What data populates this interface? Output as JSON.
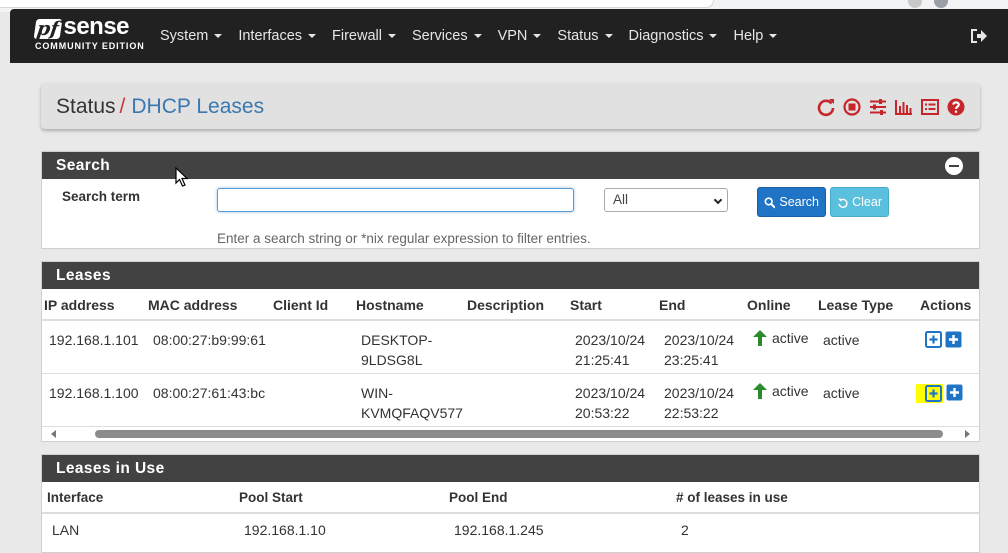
{
  "brand": {
    "logo_pf": "pf",
    "logo_sense": "sense",
    "edition": "COMMUNITY EDITION"
  },
  "nav": {
    "items": [
      "System",
      "Interfaces",
      "Firewall",
      "Services",
      "VPN",
      "Status",
      "Diagnostics",
      "Help"
    ],
    "logout_icon": "sign-out-icon"
  },
  "breadcrumb": {
    "parent": "Status",
    "separator": "/",
    "current": "DHCP Leases"
  },
  "header_icons": [
    "restart-icon",
    "stop-icon",
    "sliders-icon",
    "bar-chart-icon",
    "list-icon",
    "help-icon"
  ],
  "colors": {
    "accent_red": "#c6262b",
    "link_blue": "#3b78b0",
    "panel_heading": "#424242",
    "active_green": "#2b8a2b",
    "highlight": "#ffff00"
  },
  "search": {
    "heading": "Search",
    "label": "Search term",
    "input_value": "",
    "select_value": "All",
    "search_button": "Search",
    "clear_button": "Clear",
    "help_text": "Enter a search string or *nix regular expression to filter entries."
  },
  "leases": {
    "heading": "Leases",
    "columns": [
      "IP address",
      "MAC address",
      "Client Id",
      "Hostname",
      "Description",
      "Start",
      "End",
      "Online",
      "Lease Type",
      "Actions"
    ],
    "rows": [
      {
        "ip": "192.168.1.101",
        "mac": "08:00:27:b9:99:61",
        "client_id": "",
        "hostname_1": "DESKTOP-",
        "hostname_2": "9LDSG8L",
        "description": "",
        "start_date": "2023/10/24",
        "start_time": "21:25:41",
        "end_date": "2023/10/24",
        "end_time": "23:25:41",
        "online": "active",
        "lease_type": "active"
      },
      {
        "ip": "192.168.1.100",
        "mac": "08:00:27:61:43:bc",
        "client_id": "",
        "hostname_1": "WIN-",
        "hostname_2": "KVMQFAQV577",
        "description": "",
        "start_date": "2023/10/24",
        "start_time": "20:53:22",
        "end_date": "2023/10/24",
        "end_time": "22:53:22",
        "online": "active",
        "lease_type": "active"
      }
    ]
  },
  "in_use": {
    "heading": "Leases in Use",
    "columns": [
      "Interface",
      "Pool Start",
      "Pool End",
      "# of leases in use"
    ],
    "rows": [
      {
        "interface": "LAN",
        "pool_start": "192.168.1.10",
        "pool_end": "192.168.1.245",
        "count": "2"
      }
    ]
  }
}
